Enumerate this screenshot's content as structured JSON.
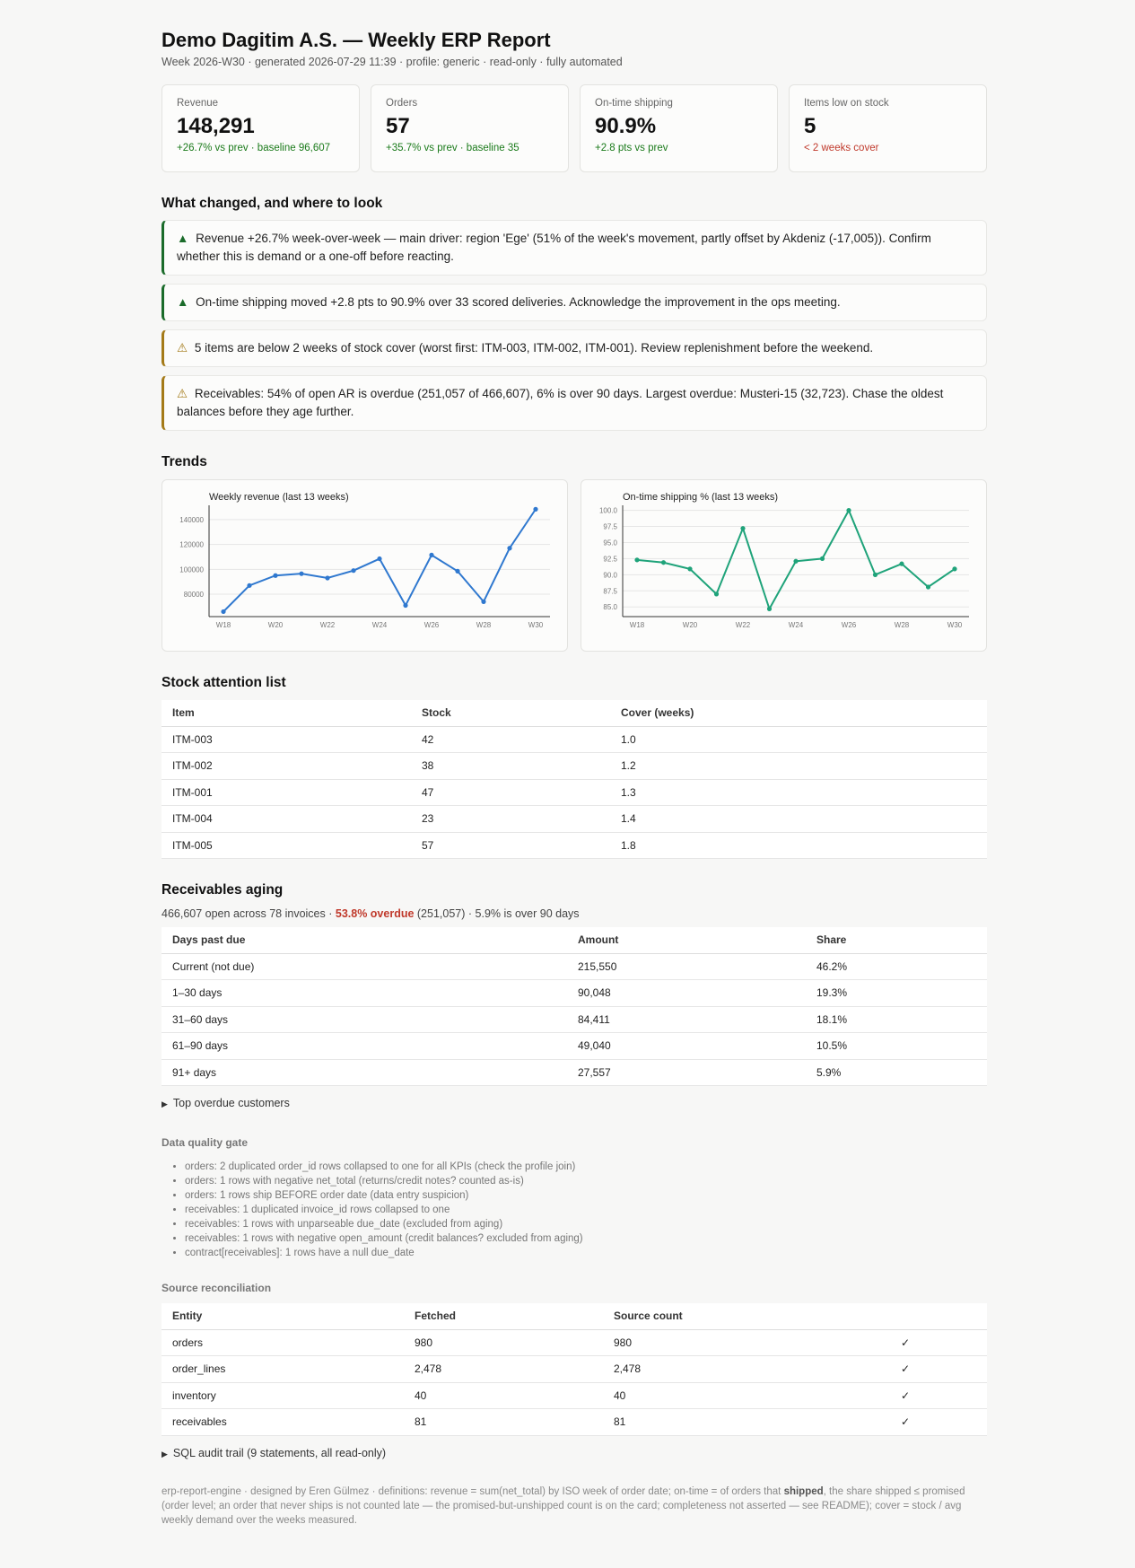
{
  "header": {
    "title": "Demo Dagitim A.S. — Weekly ERP Report",
    "subtitle": "Week 2026-W30 · generated 2026-07-29 11:39 · profile: generic · read-only · fully automated"
  },
  "kpis": [
    {
      "label": "Revenue",
      "value": "148,291",
      "delta": "+26.7% vs prev · baseline 96,607",
      "tone": "pos"
    },
    {
      "label": "Orders",
      "value": "57",
      "delta": "+35.7% vs prev · baseline 35",
      "tone": "pos"
    },
    {
      "label": "On-time shipping",
      "value": "90.9%",
      "delta": "+2.8 pts vs prev",
      "tone": "pos"
    },
    {
      "label": "Items low on stock",
      "value": "5",
      "delta": "< 2 weeks cover",
      "tone": "neg"
    }
  ],
  "changed": {
    "heading": "What changed, and where to look",
    "items": [
      {
        "kind": "up",
        "icon": "▲",
        "text": "Revenue +26.7% week-over-week — main driver: region 'Ege' (51% of the week's movement, partly offset by Akdeniz (-17,005)). Confirm whether this is demand or a one-off before reacting."
      },
      {
        "kind": "up",
        "icon": "▲",
        "text": "On-time shipping moved +2.8 pts to 90.9% over 33 scored deliveries. Acknowledge the improvement in the ops meeting."
      },
      {
        "kind": "warn",
        "icon": "⚠",
        "text": "5 items are below 2 weeks of stock cover (worst first: ITM-003, ITM-002, ITM-001). Review replenishment before the weekend."
      },
      {
        "kind": "warn",
        "icon": "⚠",
        "text": "Receivables: 54% of open AR is overdue (251,057 of 466,607), 6% is over 90 days. Largest overdue: Musteri-15 (32,723). Chase the oldest balances before they age further."
      }
    ]
  },
  "trends": {
    "heading": "Trends"
  },
  "chart_data": [
    {
      "type": "line",
      "title": "Weekly revenue (last 13 weeks)",
      "categories": [
        "W18",
        "W19",
        "W20",
        "W21",
        "W22",
        "W23",
        "W24",
        "W25",
        "W26",
        "W27",
        "W28",
        "W29",
        "W30"
      ],
      "tick_labels": [
        "W18",
        "W20",
        "W22",
        "W24",
        "W26",
        "W28",
        "W30"
      ],
      "values": [
        66000,
        87000,
        95000,
        96500,
        93000,
        99000,
        108500,
        71000,
        111500,
        98500,
        74000,
        117000,
        148291
      ],
      "y_ticks": [
        "80000",
        "100000",
        "120000",
        "140000"
      ],
      "ylim": [
        62000,
        150000
      ],
      "color": "#2f78cf"
    },
    {
      "type": "line",
      "title": "On-time shipping % (last 13 weeks)",
      "categories": [
        "W18",
        "W19",
        "W20",
        "W21",
        "W22",
        "W23",
        "W24",
        "W25",
        "W26",
        "W27",
        "W28",
        "W29",
        "W30"
      ],
      "tick_labels": [
        "W18",
        "W20",
        "W22",
        "W24",
        "W26",
        "W28",
        "W30"
      ],
      "values": [
        92.3,
        91.9,
        90.9,
        87.0,
        97.2,
        84.7,
        92.1,
        92.5,
        100.0,
        90.0,
        91.7,
        88.1,
        90.9
      ],
      "y_ticks": [
        "85.0",
        "87.5",
        "90.0",
        "92.5",
        "95.0",
        "97.5",
        "100.0"
      ],
      "ylim": [
        83.5,
        100.5
      ],
      "color": "#1fa37a"
    }
  ],
  "stock": {
    "heading": "Stock attention list",
    "columns": [
      "Item",
      "Stock",
      "Cover (weeks)"
    ],
    "rows": [
      [
        "ITM-003",
        "42",
        "1.0"
      ],
      [
        "ITM-002",
        "38",
        "1.2"
      ],
      [
        "ITM-001",
        "47",
        "1.3"
      ],
      [
        "ITM-004",
        "23",
        "1.4"
      ],
      [
        "ITM-005",
        "57",
        "1.8"
      ]
    ]
  },
  "receivables": {
    "heading": "Receivables aging",
    "summary_pre": "466,607 open across 78 invoices · ",
    "summary_overdue": "53.8% overdue",
    "summary_post": " (251,057) · 5.9% is over 90 days",
    "columns": [
      "Days past due",
      "Amount",
      "Share"
    ],
    "rows": [
      [
        "Current (not due)",
        "215,550",
        "46.2%"
      ],
      [
        "1–30 days",
        "90,048",
        "19.3%"
      ],
      [
        "31–60 days",
        "84,411",
        "18.1%"
      ],
      [
        "61–90 days",
        "49,040",
        "10.5%"
      ],
      [
        "91+ days",
        "27,557",
        "5.9%"
      ]
    ],
    "top_overdue_label": "Top overdue customers"
  },
  "data_quality": {
    "heading": "Data quality gate",
    "items": [
      "orders: 2 duplicated order_id rows collapsed to one for all KPIs (check the profile join)",
      "orders: 1 rows with negative net_total (returns/credit notes? counted as-is)",
      "orders: 1 rows ship BEFORE order date (data entry suspicion)",
      "receivables: 1 duplicated invoice_id rows collapsed to one",
      "receivables: 1 rows with unparseable due_date (excluded from aging)",
      "receivables: 1 rows with negative open_amount (credit balances? excluded from aging)",
      "contract[receivables]: 1 rows have a null due_date"
    ]
  },
  "reconciliation": {
    "heading": "Source reconciliation",
    "columns": [
      "Entity",
      "Fetched",
      "Source count",
      ""
    ],
    "rows": [
      [
        "orders",
        "980",
        "980",
        "✓"
      ],
      [
        "order_lines",
        "2,478",
        "2,478",
        "✓"
      ],
      [
        "inventory",
        "40",
        "40",
        "✓"
      ],
      [
        "receivables",
        "81",
        "81",
        "✓"
      ]
    ],
    "sql_audit_label": "SQL audit trail (9 statements, all read-only)"
  },
  "footer": {
    "pre": "erp-report-engine · designed by Eren Gülmez · definitions: revenue = sum(net_total) by ISO week of order date; on-time = of orders that ",
    "bold": "shipped",
    "post": ", the share shipped ≤ promised (order level; an order that never ships is not counted late — the promised-but-unshipped count is on the card; completeness not asserted — see README); cover = stock / avg weekly demand over the weeks measured."
  },
  "disclosure_icon": "▶"
}
